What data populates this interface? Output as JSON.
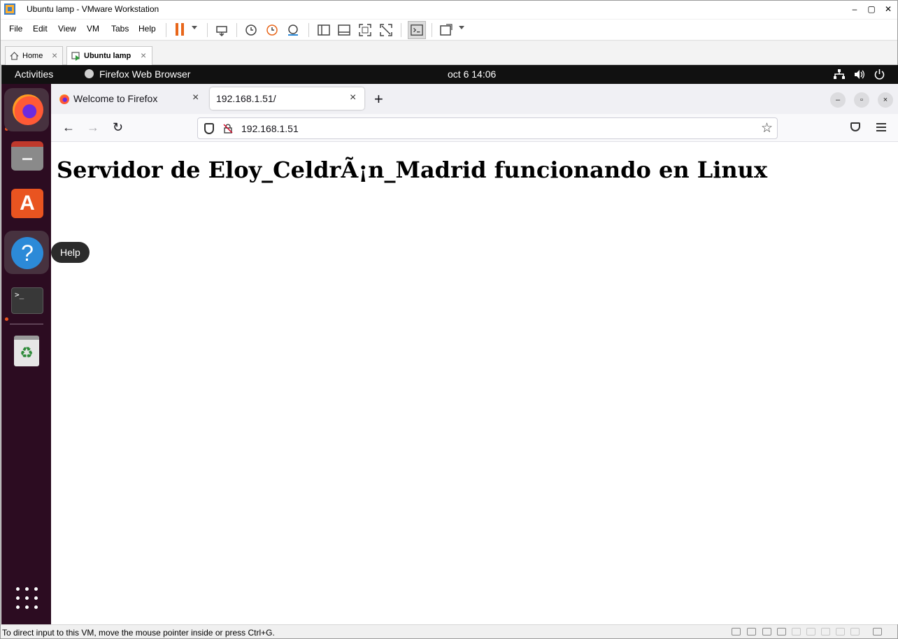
{
  "window": {
    "title": "Ubuntu lamp - VMware Workstation",
    "minimize_icon": "minimize-icon",
    "maximize_icon": "maximize-icon",
    "close_icon": "close-icon"
  },
  "menu": [
    "File",
    "Edit",
    "View",
    "VM",
    "Tabs",
    "Help"
  ],
  "toolbar": {
    "icons": [
      "pause-icon",
      "send-ctrl-alt-del-icon",
      "snapshot-take-icon",
      "snapshot-revert-icon",
      "snapshot-manager-icon",
      "library-icon",
      "thumbnail-bar-icon",
      "full-screen-icon",
      "unity-icon",
      "console-view-icon",
      "stretch-guest-icon"
    ],
    "pause_color": "#e8661a"
  },
  "vm_tabs": [
    {
      "label": "Home",
      "close": "×"
    },
    {
      "label": "Ubuntu lamp",
      "close": "×"
    }
  ],
  "ubuntu": {
    "activities": "Activities",
    "app_name": "Firefox Web Browser",
    "clock": "oct 6  14:06",
    "tray_icons": [
      "network-icon",
      "volume-icon",
      "power-icon"
    ],
    "accent_color": "#e95420",
    "dock": [
      "firefox-icon",
      "files-icon",
      "app-center-icon",
      "help-icon",
      "terminal-icon",
      "trash-icon",
      "show-apps-icon"
    ],
    "tooltip": "Help",
    "terminal_glyph": ">_",
    "trash_glyph": "♻",
    "help_glyph": "?",
    "store_glyph": "A"
  },
  "firefox": {
    "tabs": [
      {
        "label": "Welcome to Firefox",
        "close": "×"
      },
      {
        "label": "192.168.1.51/",
        "close": "×"
      }
    ],
    "new_tab": "+",
    "window_controls": [
      "–",
      "▫",
      "×"
    ],
    "nav": {
      "back": "←",
      "forward": "→",
      "reload": "↻"
    },
    "url": "192.168.1.51",
    "bookmark_star": "☆"
  },
  "page": {
    "heading": "Servidor de Eloy_CeldrÃ¡n_Madrid funcionando en Linux"
  },
  "status": {
    "message": "To direct input to this VM, move the mouse pointer inside or press Ctrl+G."
  }
}
